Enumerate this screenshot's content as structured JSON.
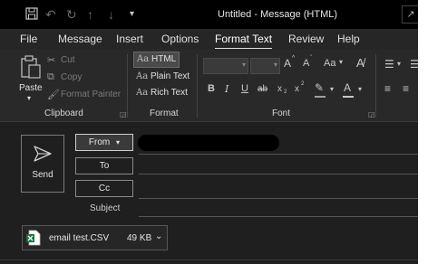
{
  "window": {
    "title": "Untitled  -  Message (HTML)"
  },
  "tabs": [
    "File",
    "Message",
    "Insert",
    "Options",
    "Format Text",
    "Review",
    "Help"
  ],
  "ribbon": {
    "clipboard": {
      "paste": "Paste",
      "cut": "Cut",
      "copy": "Copy",
      "format_painter": "Format Painter",
      "label": "Clipboard"
    },
    "format": {
      "html": "HTML",
      "plain_text": "Plain Text",
      "rich_text": "Rich Text",
      "aa": "Aa",
      "label": "Format"
    },
    "font": {
      "grow": "A",
      "shrink": "A",
      "case": "Aa",
      "bold": "B",
      "italic": "I",
      "underline": "U",
      "strike": "ab",
      "subscript": "x",
      "sub_mark": "2",
      "superscript": "x",
      "sup_mark": "2",
      "font_color": "A",
      "label": "Font"
    }
  },
  "compose": {
    "send_label": "Send",
    "from_label": "From",
    "to_label": "To",
    "cc_label": "Cc",
    "subject_label": "Subject",
    "attachment": {
      "name": "email test.CSV",
      "size": "49 KB"
    }
  }
}
